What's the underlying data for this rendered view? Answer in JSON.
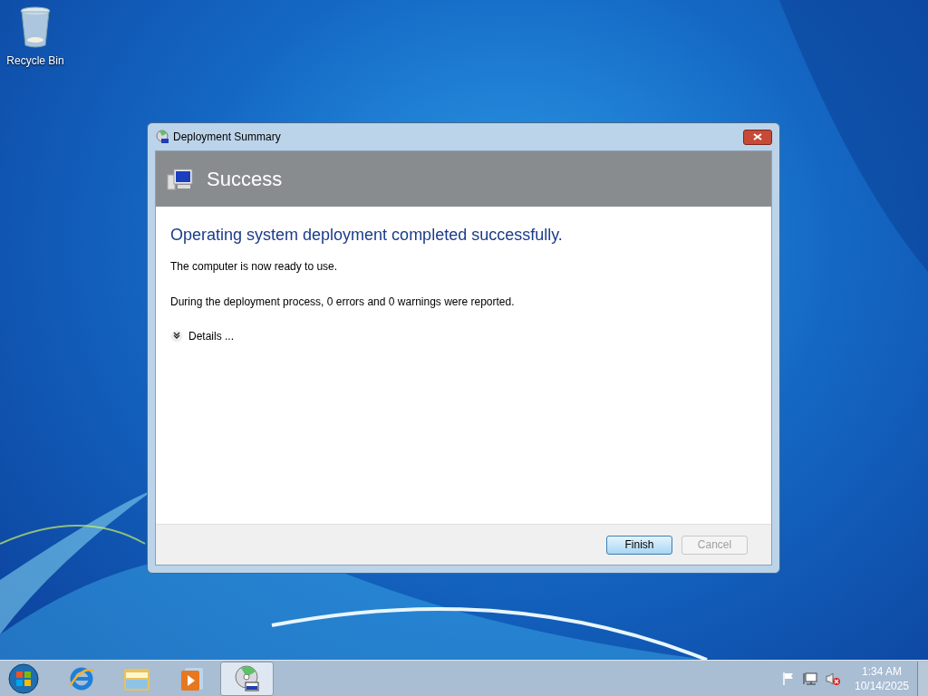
{
  "desktop_icons": [
    {
      "label": "Recycle Bin"
    }
  ],
  "dialog": {
    "title": "Deployment Summary",
    "header": "Success",
    "heading": "Operating system deployment completed successfully.",
    "lines": [
      "The computer is now ready to use.",
      "During the deployment process, 0 errors and 0 warnings were reported."
    ],
    "details": {
      "label": "Details ...",
      "expanded": false
    },
    "buttons": [
      {
        "label": "Finish",
        "disabled": false
      },
      {
        "label": "Cancel",
        "disabled": true
      }
    ]
  },
  "taskbar": {
    "items": [
      {
        "kind": "browser",
        "selected": false
      },
      {
        "kind": "folder",
        "selected": false
      },
      {
        "kind": "media",
        "selected": false
      },
      {
        "kind": "deploy",
        "selected": true
      }
    ],
    "time": "1:34 AM",
    "date": "10/14/2025"
  }
}
